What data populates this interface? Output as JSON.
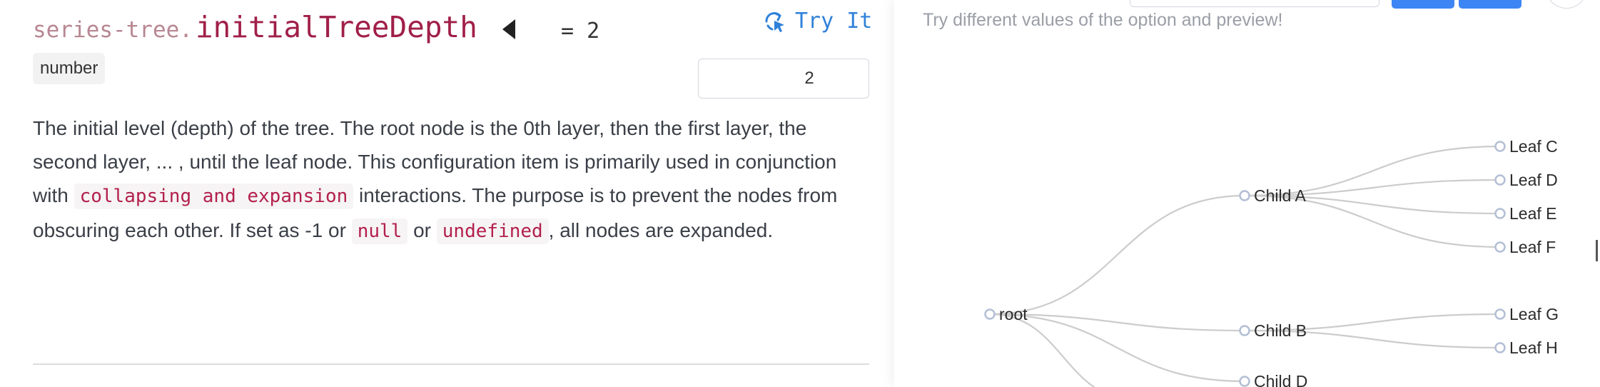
{
  "option": {
    "prefix": "series-tree.",
    "name": "initialTreeDepth",
    "default_display": "= 2",
    "type_badge": "number",
    "try_it_label": "Try It",
    "try_it_icon": "refresh-cursor-icon",
    "collapse_icon": "caret-left-icon"
  },
  "stepper": {
    "value": "2",
    "up_icon": "chevron-up-icon",
    "down_icon": "chevron-down-icon"
  },
  "description": {
    "t1": "The initial level (depth) of the tree. The root node is the 0th layer, then the first layer, the second layer, ... , until the leaf node. This configuration item is primarily used in conjunction with ",
    "c1": "collapsing and expansion",
    "t2": " interactions. The purpose is to prevent the nodes from obscuring each other. If set as -1 or ",
    "c2": "null",
    "t3": " or ",
    "c3": "undefined",
    "t4": ", all nodes are expanded."
  },
  "preview": {
    "hint": "Try different values of the option and preview!",
    "colors": {
      "link": "#cccccc",
      "node_stroke": "#b3bfd4",
      "label": "#2b2b2b"
    }
  },
  "tree": {
    "root": "root",
    "children": [
      {
        "name": "Child A",
        "leaves": [
          "Leaf C",
          "Leaf D",
          "Leaf E",
          "Leaf F"
        ]
      },
      {
        "name": "Child B",
        "leaves": [
          "Leaf G",
          "Leaf H"
        ]
      },
      {
        "name": "Child D",
        "leaves": []
      }
    ]
  }
}
